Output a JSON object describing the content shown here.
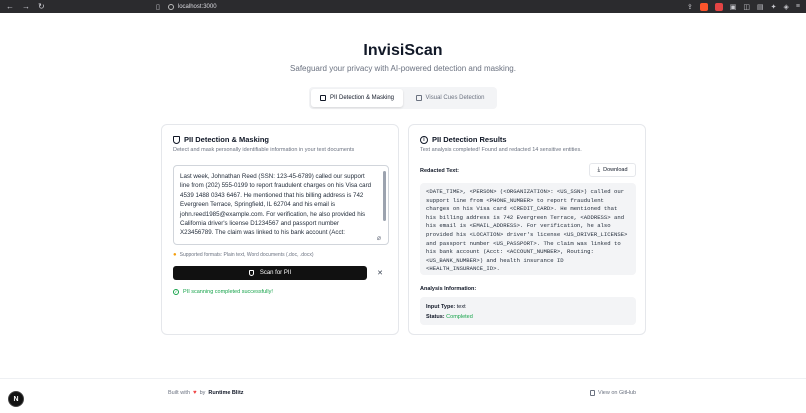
{
  "browser": {
    "url": "localhost:3000",
    "nav_back": "←",
    "nav_forward": "→",
    "nav_reload": "↻",
    "brave_badge": "1"
  },
  "header": {
    "title": "InvisiScan",
    "subtitle": "Safeguard your privacy with AI-powered detection and masking."
  },
  "tabs": [
    {
      "label": "PII Detection & Masking",
      "active": true
    },
    {
      "label": "Visual Cues Detection",
      "active": false
    }
  ],
  "left_card": {
    "title": "PII Detection & Masking",
    "description": "Detect and mask personally identifiable information in your text documents",
    "input_text": "Last week, Johnathan Reed (SSN: 123-45-6789) called our support line from (202) 555-0199 to report fraudulent charges on his Visa card 4539 1488 0343 6467. He mentioned that his billing address is 742 Evergreen Terrace, Springfield, IL 62704 and his email is john.reed1985@example.com. For verification, he also provided his California driver's license D1234567 and passport number X23456789. The claim was linked to his bank account (Acct:",
    "formats_text": "Supported formats: Plain text, Word documents (.doc, .docx)",
    "scan_button": "Scan for PII",
    "close_symbol": "✕",
    "success_message": "PII scanning completed successfully!"
  },
  "right_card": {
    "title": "PII Detection Results",
    "description": "Text analysis completed! Found and redacted 14 sensitive entities.",
    "redacted_label": "Redacted Text:",
    "download_button": "Download",
    "redacted_text": "<DATE_TIME>, <PERSON> (<ORGANIZATION>: <US_SSN>) called our support line from <PHONE_NUMBER> to report fraudulent charges on his Visa card <CREDIT_CARD>. He mentioned that his billing address is 742 Evergreen Terrace, <ADDRESS> and his email is <EMAIL_ADDRESS>. For verification, he also provided his <LOCATION> driver's license <US_DRIVER_LICENSE> and passport number <US_PASSPORT>. The claim was linked to his bank account (Acct: <ACCOUNT_NUMBER>, Routing: <US_BANK_NUMBER>) and health insurance ID <HEALTH_INSURANCE_ID>.",
    "analysis_label": "Analysis Information:",
    "input_type_key": "Input Type:",
    "input_type_value": "text",
    "status_key": "Status:",
    "status_value": "Completed"
  },
  "footer": {
    "built_with": "Built with",
    "by": "by",
    "brand": "Runtime Blitz",
    "github": "View on GitHub"
  },
  "corner_badge": "N",
  "colors": {
    "success": "#16a34a",
    "primary_button": "#111111",
    "heart": "#ef4444"
  }
}
